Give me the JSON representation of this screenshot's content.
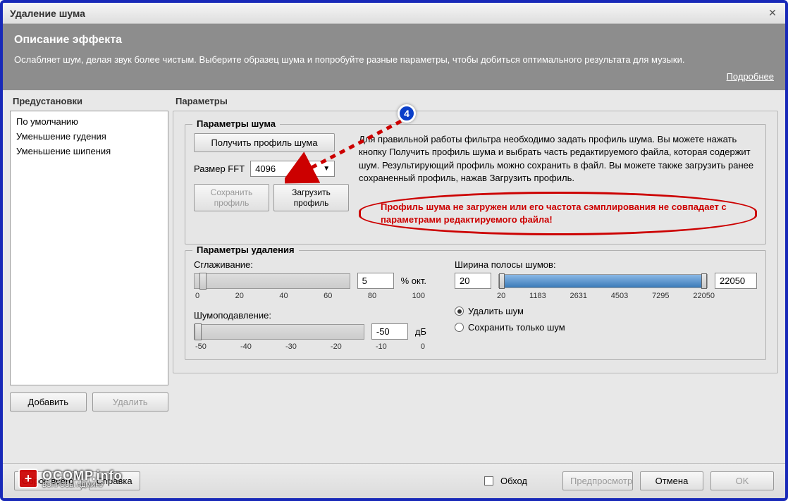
{
  "window": {
    "title": "Удаление шума"
  },
  "description": {
    "heading": "Описание эффекта",
    "text": "Ослабляет шум, делая звук более чистым. Выберите образец шума и попробуйте разные параметры, чтобы добиться оптимального результата для музыки.",
    "more": "Подробнее"
  },
  "presets": {
    "label": "Предустановки",
    "items": [
      "По умолчанию",
      "Уменьшение гудения",
      "Уменьшение шипения"
    ],
    "add": "Добавить",
    "delete": "Удалить"
  },
  "params": {
    "label": "Параметры",
    "noise": {
      "legend": "Параметры шума",
      "get_profile": "Получить профиль шума",
      "help_text": "Для правильной работы фильтра необходимо задать профиль шума. Вы можете нажать кнопку Получить профиль шума и выбрать часть редактируемого файла, которая содержит шум. Результирующий профиль можно сохранить в файл. Вы можете также загрузить ранее сохраненный профиль, нажав Загрузить профиль.",
      "fft_label": "Размер FFT",
      "fft_value": "4096",
      "save_profile": "Сохранить профиль",
      "load_profile": "Загрузить профиль",
      "error": "Профиль шума не загружен или его частота сэмплирования не совпадает с параметрами редактируемого файла!"
    },
    "removal": {
      "legend": "Параметры удаления",
      "smoothing_label": "Сглаживание:",
      "smoothing_value": "5",
      "smoothing_unit": "% окт.",
      "smoothing_ticks": [
        "0",
        "20",
        "40",
        "60",
        "80",
        "100"
      ],
      "reduction_label": "Шумоподавление:",
      "reduction_value": "-50",
      "reduction_unit": "дБ",
      "reduction_ticks": [
        "-50",
        "-40",
        "-30",
        "-20",
        "-10",
        "0"
      ],
      "band_label": "Ширина полосы шумов:",
      "band_low": "20",
      "band_high": "22050",
      "band_ticks": [
        "20",
        "1183",
        "2631",
        "4503",
        "7295",
        "22050"
      ],
      "radio_remove": "Удалить шум",
      "radio_keep": "Сохранить только шум"
    }
  },
  "footer": {
    "reset": "Сброс всего",
    "help": "Справка",
    "bypass": "Обход",
    "preview": "Предпросмотр",
    "cancel": "Отмена",
    "ok": "OK"
  },
  "annotation": {
    "badge": "4"
  },
  "watermark": {
    "line1": "OCOMP.info",
    "line2": "ВОПРОСЫ АДМИНУ"
  }
}
